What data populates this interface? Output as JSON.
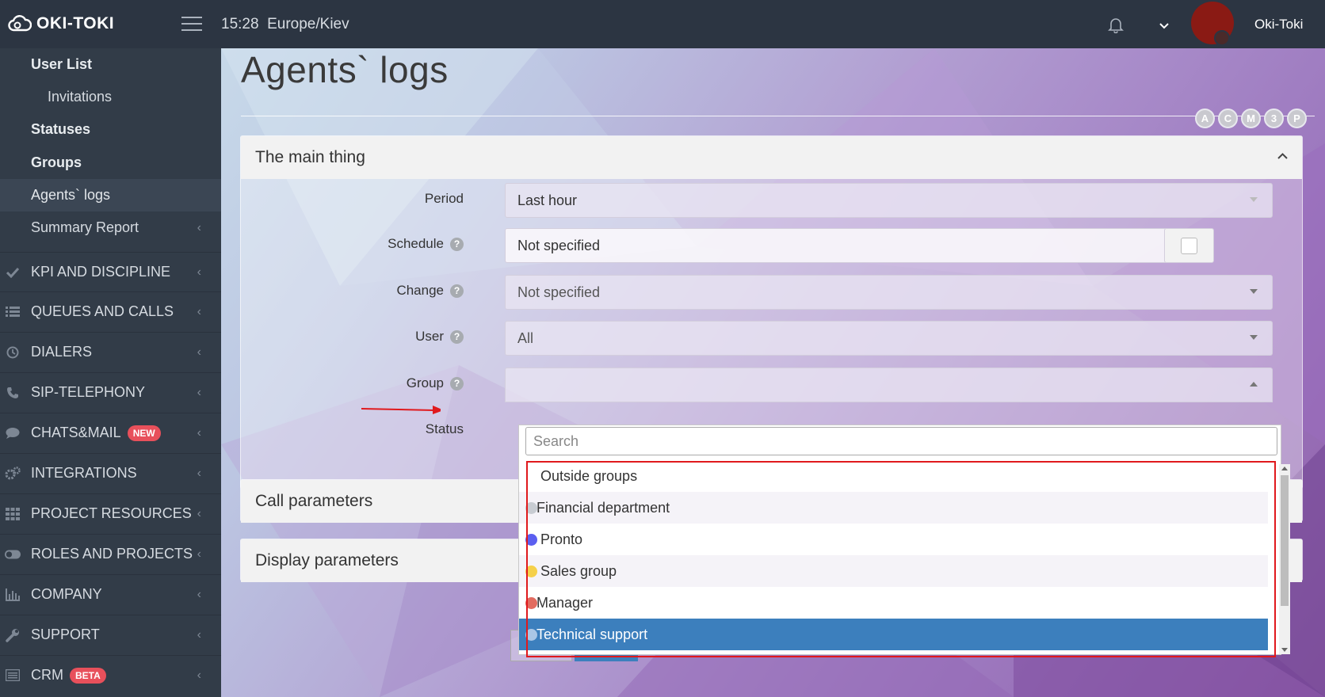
{
  "header": {
    "logo_text": "OKI-TOKI",
    "time": "15:28",
    "timezone": "Europe/Kiev",
    "username": "Oki-Toki"
  },
  "sidebar": {
    "sub_items": [
      {
        "label": "User List",
        "bold": true
      },
      {
        "label": "Invitations",
        "bold": false
      },
      {
        "label": "Statuses",
        "bold": true
      },
      {
        "label": "Groups",
        "bold": true
      },
      {
        "label": "Agents` logs",
        "active": true
      },
      {
        "label": "Summary Report"
      }
    ],
    "menu_items": [
      {
        "label": "KPI AND DISCIPLINE",
        "icon": "check-icon"
      },
      {
        "label": "QUEUES AND CALLS",
        "icon": "list-icon"
      },
      {
        "label": "DIALERS",
        "icon": "clock-icon"
      },
      {
        "label": "SIP-TELEPHONY",
        "icon": "phone-icon"
      },
      {
        "label": "CHATS&MAIL",
        "icon": "chat-icon",
        "badge": "NEW"
      },
      {
        "label": "INTEGRATIONS",
        "icon": "gears-icon"
      },
      {
        "label": "PROJECT RESOURCES",
        "icon": "grid-icon"
      },
      {
        "label": "ROLES AND PROJECTS",
        "icon": "toggle-icon"
      },
      {
        "label": "COMPANY",
        "icon": "bar-chart-icon"
      },
      {
        "label": "SUPPORT",
        "icon": "wrench-icon"
      },
      {
        "label": "CRM",
        "icon": "table-icon",
        "badge": "BETA"
      }
    ]
  },
  "main": {
    "title": "Agents` logs",
    "mode_circles": [
      "A",
      "C",
      "M",
      "3",
      "P"
    ],
    "panel_main": {
      "title": "The main thing",
      "fields": {
        "period": {
          "label": "Period",
          "value": "Last hour"
        },
        "schedule": {
          "label": "Schedule",
          "value": "Not specified"
        },
        "change": {
          "label": "Change",
          "value": "Not specified"
        },
        "user": {
          "label": "User",
          "value": "All"
        },
        "group": {
          "label": "Group",
          "value": ""
        },
        "status": {
          "label": "Status"
        }
      }
    },
    "panel_call": {
      "title": "Call parameters"
    },
    "panel_display": {
      "title": "Display parameters"
    },
    "group_dropdown": {
      "search_placeholder": "Search",
      "options": [
        {
          "label": "Outside groups",
          "color": ""
        },
        {
          "label": "Financial department",
          "color": "#c8ccd2"
        },
        {
          "label": "Pronto",
          "color": "#5b5ff0"
        },
        {
          "label": "Sales group",
          "color": "#f5d04a"
        },
        {
          "label": "Manager",
          "color": "#e26c60"
        },
        {
          "label": "Technical support",
          "color": "#a9c6e6",
          "selected": true
        }
      ]
    }
  },
  "colors": {
    "sidebar_bg": "#323c48",
    "topbar_bg": "#2c3542",
    "selected_option": "#3c7fbd",
    "highlight_box": "#e0191d",
    "badge": "#e8505b"
  }
}
